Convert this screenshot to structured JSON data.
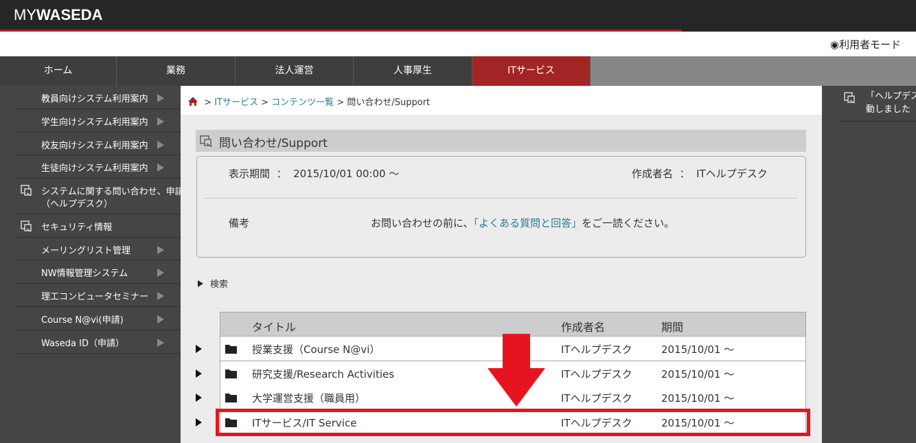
{
  "header": {
    "logo_my": "MY",
    "logo_waseda": "WASEDA",
    "mode_label": "◉利用者モード"
  },
  "nav": {
    "items": [
      {
        "label": "ホーム"
      },
      {
        "label": "業務"
      },
      {
        "label": "法人運営"
      },
      {
        "label": "人事厚生"
      },
      {
        "label": "ITサービス"
      }
    ],
    "active": "ITサービス"
  },
  "sidebar": {
    "items": [
      {
        "label": "教員向けシステム利用案内"
      },
      {
        "label": "学生向けシステム利用案内"
      },
      {
        "label": "校友向けシステム利用案内"
      },
      {
        "label": "生徒向けシステム利用案内"
      },
      {
        "label": "システムに関する問い合わせ、申請",
        "label2": "（ヘルプデスク）"
      },
      {
        "label": "セキュリティ情報"
      },
      {
        "label": "メーリングリスト管理"
      },
      {
        "label": "NW情報管理システム"
      },
      {
        "label": "理工コンピュータセミナー"
      },
      {
        "label": "Course N@vi(申請)"
      },
      {
        "label": "Waseda ID（申請）"
      }
    ]
  },
  "breadcrumb": {
    "sep": ">",
    "items": [
      "ITサービス",
      "コンテンツ一覧",
      "問い合わせ/Support"
    ]
  },
  "section": {
    "title": "問い合わせ/Support"
  },
  "info": {
    "period_label": "表示期間",
    "colon": "：",
    "period_value": "2015/10/01 00:00 〜",
    "author_label": "作成者名",
    "author_value": "ITヘルプデスク",
    "note_label": "備考",
    "note_prefix": "お問い合わせの前に、",
    "note_link": "「よくある質問と回答」",
    "note_suffix": "をご一読ください。"
  },
  "search": {
    "label": "検索"
  },
  "table": {
    "headers": {
      "title": "タイトル",
      "author": "作成者名",
      "period": "期間"
    },
    "rows": [
      {
        "title": "授業支援（Course N@vi）",
        "author": "ITヘルプデスク",
        "period": "2015/10/01 〜"
      },
      {
        "title": "研究支援/Research Activities",
        "author": "ITヘルプデスク",
        "period": "2015/10/01 〜"
      },
      {
        "title": "大学運営支援（職員用）",
        "author": "ITヘルプデスク",
        "period": "2015/10/01 〜"
      },
      {
        "title": "ITサービス/IT Service",
        "author": "ITヘルプデスク",
        "period": "2015/10/01 〜"
      }
    ]
  },
  "rightpanel": {
    "item_line1": "「ヘルプデス",
    "item_line2": "動しました"
  },
  "colors": {
    "accent_red": "#a32424",
    "highlight_red": "#e5141e",
    "link": "#2a7a9a"
  }
}
